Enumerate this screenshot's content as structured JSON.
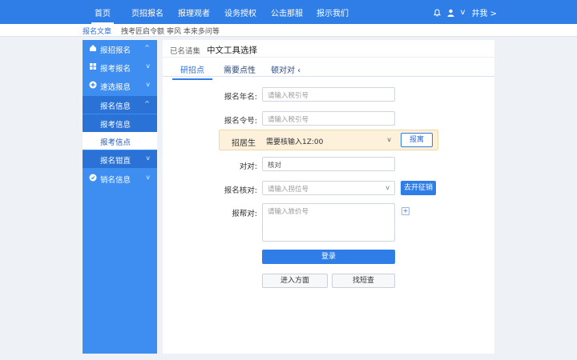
{
  "topnav": {
    "items": [
      "首页",
      "页招报名",
      "报理观者",
      "设务授权",
      "公击那服",
      "报示我们"
    ],
    "user_label": "井我 >"
  },
  "subbar": {
    "crumbs": [
      "报名文章",
      "拽考匠启令额",
      "寧风 本来多问等"
    ]
  },
  "sidebar": {
    "items": [
      {
        "label": "报招报名",
        "chev": "^"
      },
      {
        "label": "报考报名",
        "chev": "v"
      },
      {
        "label": "速选报息",
        "chev": "v"
      },
      {
        "label": "报名信息",
        "chev": "^"
      },
      {
        "label": "报考信息",
        "chev": ""
      },
      {
        "label": "报考信点",
        "chev": ""
      },
      {
        "label": "报名钳直",
        "chev": "v"
      },
      {
        "label": "销名信息",
        "chev": "v"
      }
    ]
  },
  "main": {
    "hint": "已名请集",
    "title": "中文工具选择",
    "tabs": [
      "研招点",
      "需要点性",
      "顿对对 ‹"
    ],
    "fields": {
      "year_label": "报名年名:",
      "year_placeholder": "请输入税引号",
      "num_label": "报名令号:",
      "num_placeholder": "请输入税引号",
      "hl_label": "招居生",
      "hl_value": "需要核输入1Z:00",
      "hl_button": "报寓",
      "dui_label": "对对:",
      "dui_value": "核对",
      "sel_label": "报名核对:",
      "sel_placeholder": "请输入拐位号",
      "sel_button": "去开征销",
      "area_label": "报帮对:",
      "area_placeholder": "请输入旅价号"
    },
    "login_button": "登录",
    "enter_button": "进入方面",
    "query_button": "找短查"
  }
}
